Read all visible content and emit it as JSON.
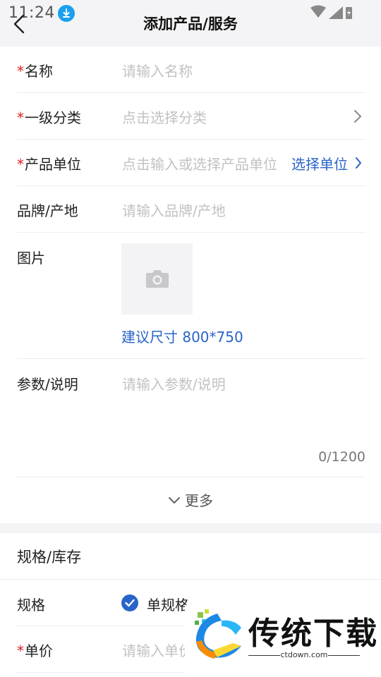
{
  "status_bar": {
    "time": "11:24"
  },
  "header": {
    "title": "添加产品/服务"
  },
  "form": {
    "required_mark": "*",
    "name": {
      "label": "名称",
      "placeholder": "请输入名称"
    },
    "category": {
      "label": "一级分类",
      "placeholder": "点击选择分类"
    },
    "unit": {
      "label": "产品单位",
      "placeholder": "点击输入或选择产品单位",
      "action": "选择单位"
    },
    "brand": {
      "label": "品牌/产地",
      "placeholder": "请输入品牌/产地"
    },
    "image": {
      "label": "图片",
      "hint": "建议尺寸 800*750"
    },
    "params": {
      "label": "参数/说明",
      "placeholder": "请输入参数/说明",
      "counter": "0/1200"
    },
    "more": "更多"
  },
  "spec_section": {
    "title": "规格/库存",
    "spec": {
      "label": "规格",
      "option": "单规格"
    },
    "price": {
      "label": "单价",
      "placeholder": "请输入单价"
    }
  },
  "watermark": {
    "text": "传统下载",
    "url": "ctdown.com"
  },
  "colors": {
    "accent": "#2a64c8",
    "required": "#e02020",
    "placeholder": "#c2c2c2"
  }
}
